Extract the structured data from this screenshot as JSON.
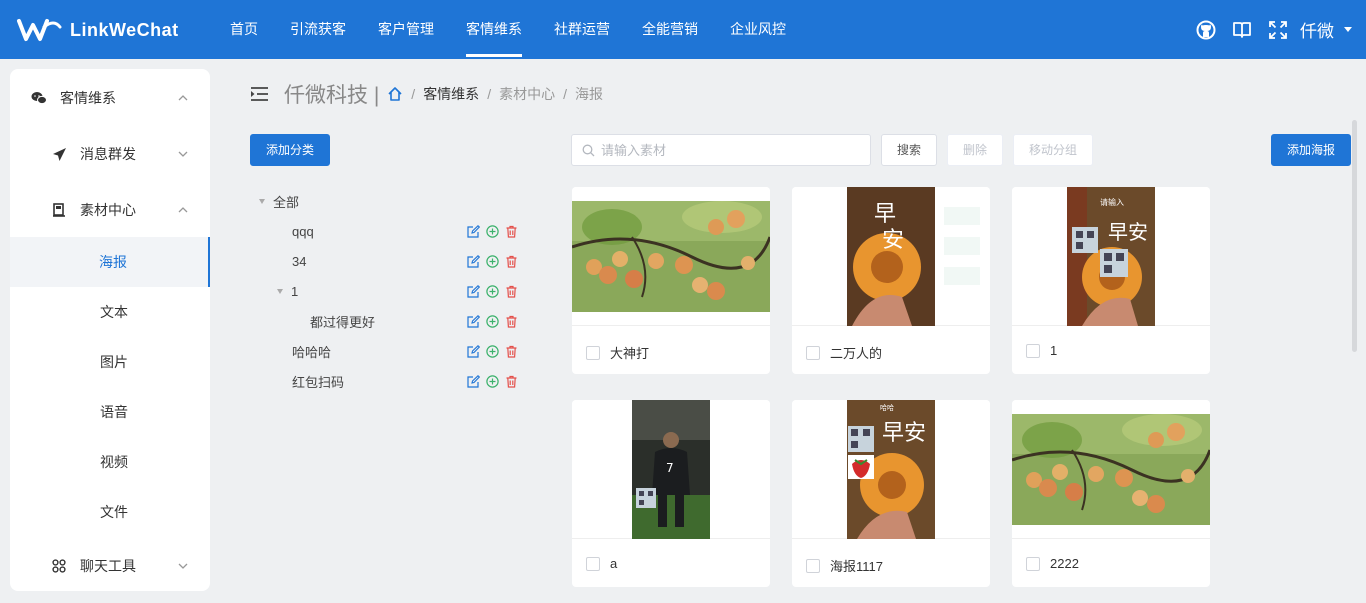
{
  "brand": {
    "name": "LinkWeChat"
  },
  "nav": [
    {
      "label": "首页",
      "active": false
    },
    {
      "label": "引流获客",
      "active": false
    },
    {
      "label": "客户管理",
      "active": false
    },
    {
      "label": "客情维系",
      "active": true
    },
    {
      "label": "社群运营",
      "active": false
    },
    {
      "label": "全能营销",
      "active": false
    },
    {
      "label": "企业风控",
      "active": false
    }
  ],
  "header": {
    "user": "仟微"
  },
  "sidebar": {
    "group": "客情维系",
    "items": [
      {
        "label": "消息群发"
      },
      {
        "label": "素材中心"
      }
    ],
    "sub": [
      {
        "label": "海报",
        "active": true
      },
      {
        "label": "文本"
      },
      {
        "label": "图片"
      },
      {
        "label": "语音"
      },
      {
        "label": "视频"
      },
      {
        "label": "文件"
      }
    ],
    "last": {
      "label": "聊天工具"
    }
  },
  "breadcrumb": {
    "company": "仟微科技 |",
    "items": [
      "客情维系",
      "素材中心",
      "海报"
    ],
    "sep": "/"
  },
  "toolbar": {
    "add_category": "添加分类",
    "search_placeholder": "请输入素材",
    "search": "搜索",
    "delete": "删除",
    "move_group": "移动分组",
    "add_poster": "添加海报"
  },
  "tree": [
    {
      "label": "全部",
      "level": 0,
      "expanded": true,
      "actions": false
    },
    {
      "label": "qqq",
      "level": 1,
      "actions": true
    },
    {
      "label": "34",
      "level": 1,
      "actions": true
    },
    {
      "label": "1",
      "level": 1,
      "expanded": true,
      "actions": true
    },
    {
      "label": "都过得更好",
      "level": 2,
      "actions": true
    },
    {
      "label": "哈哈哈",
      "level": 1,
      "actions": true
    },
    {
      "label": "红包扫码",
      "level": 1,
      "actions": true
    }
  ],
  "cards": [
    {
      "title": "大神打",
      "image": "fruit-branch"
    },
    {
      "title": "二万人的",
      "image": "morning-poster"
    },
    {
      "title": "1",
      "image": "qr-poster"
    },
    {
      "title": "a",
      "image": "football-poster"
    },
    {
      "title": "海报1117",
      "image": "strawberry-poster"
    },
    {
      "title": "2222",
      "image": "fruit-branch"
    }
  ],
  "colors": {
    "primary": "#1f75d6",
    "edit": "#1f75d6",
    "add": "#3bb16b",
    "delete": "#e4504b"
  },
  "posters": {
    "zao": "早",
    "an": "安",
    "morning_text": "早安",
    "qr_caption": "请输入",
    "jersey_number": "7",
    "sfx_caption": "哈哈"
  }
}
